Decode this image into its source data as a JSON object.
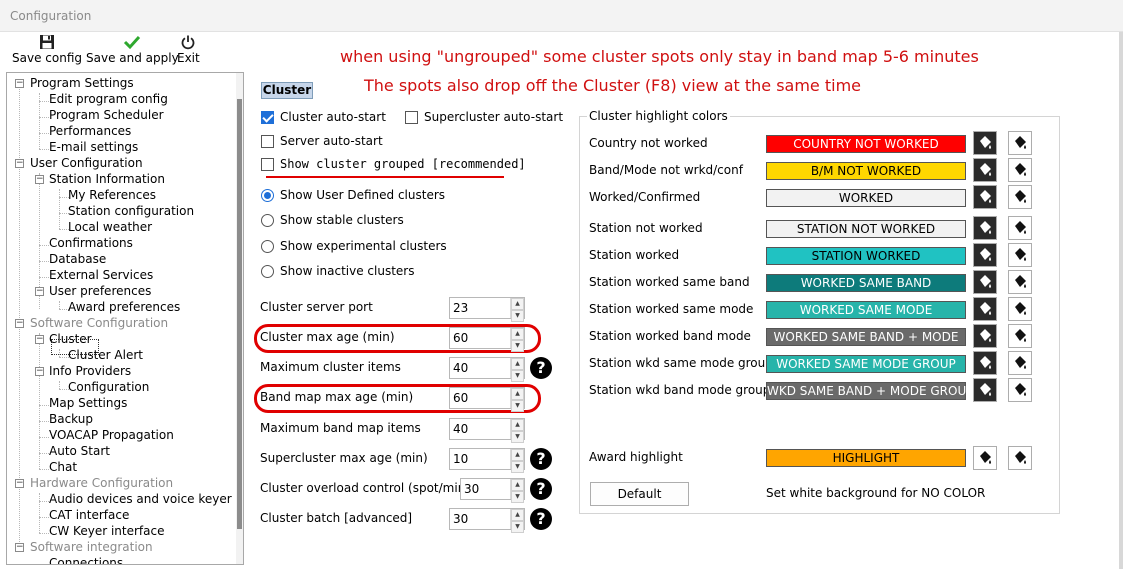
{
  "window": {
    "title": "Configuration"
  },
  "toolbar": {
    "save_config": "Save config",
    "save_apply": "Save and apply",
    "exit": "Exit"
  },
  "annotations": {
    "line1": "when using \"ungrouped\" some cluster spots only stay in band map 5-6 minutes",
    "line2": "The spots also drop off the Cluster (F8) view at the same time"
  },
  "tree": [
    {
      "label": "Program Settings"
    },
    {
      "label": "Edit program config"
    },
    {
      "label": "Program Scheduler"
    },
    {
      "label": "Performances"
    },
    {
      "label": "E-mail settings"
    },
    {
      "label": "User Configuration"
    },
    {
      "label": "Station Information"
    },
    {
      "label": "My References"
    },
    {
      "label": "Station configuration"
    },
    {
      "label": "Local weather"
    },
    {
      "label": "Confirmations"
    },
    {
      "label": "Database"
    },
    {
      "label": "External Services"
    },
    {
      "label": "User preferences"
    },
    {
      "label": "Award preferences"
    },
    {
      "label": "Software Configuration"
    },
    {
      "label": "Cluster"
    },
    {
      "label": "Cluster Alert"
    },
    {
      "label": "Info Providers"
    },
    {
      "label": "Configuration"
    },
    {
      "label": "Map Settings"
    },
    {
      "label": "Backup"
    },
    {
      "label": "VOACAP Propagation"
    },
    {
      "label": "Auto Start"
    },
    {
      "label": "Chat"
    },
    {
      "label": "Hardware Configuration"
    },
    {
      "label": "Audio devices and voice keyer"
    },
    {
      "label": "CAT interface"
    },
    {
      "label": "CW Keyer interface"
    },
    {
      "label": "Software integration"
    },
    {
      "label": "Connections"
    }
  ],
  "cluster": {
    "section_title": "Cluster",
    "checkboxes": {
      "auto_start": "Cluster auto-start",
      "supercluster_auto_start": "Supercluster auto-start",
      "server_auto_start": "Server auto-start",
      "show_grouped": "Show cluster grouped [recommended]"
    },
    "radios": {
      "user_defined": "Show User Defined clusters",
      "stable": "Show stable clusters",
      "experimental": "Show experimental clusters",
      "inactive": "Show inactive clusters"
    },
    "fields": [
      {
        "label": "Cluster server port",
        "value": "23"
      },
      {
        "label": "Cluster max age (min)",
        "value": "60"
      },
      {
        "label": "Maximum cluster items",
        "value": "40"
      },
      {
        "label": "Band map max age (min)",
        "value": "60"
      },
      {
        "label": "Maximum band map items",
        "value": "40"
      },
      {
        "label": "Supercluster max age (min)",
        "value": "10"
      },
      {
        "label": "Cluster overload control (spot/min)",
        "value": "30"
      },
      {
        "label": "Cluster batch [advanced]",
        "value": "30"
      }
    ],
    "help_glyph": "?"
  },
  "highlight": {
    "title": "Cluster highlight colors",
    "rows": [
      {
        "label": "Country not worked",
        "sample": "COUNTRY NOT WORKED",
        "bg": "#ff0000",
        "fg": "#ffffff"
      },
      {
        "label": "Band/Mode not wrkd/conf",
        "sample": "B/M NOT WORKED",
        "bg": "#ffd700",
        "fg": "#000000"
      },
      {
        "label": "Worked/Confirmed",
        "sample": "WORKED",
        "bg": "#f2f2f2",
        "fg": "#000000"
      },
      {
        "label": "Station not worked",
        "sample": "STATION NOT WORKED",
        "bg": "#f2f2f2",
        "fg": "#000000"
      },
      {
        "label": "Station worked",
        "sample": "STATION WORKED",
        "bg": "#20c2c2",
        "fg": "#000000"
      },
      {
        "label": "Station worked same band",
        "sample": "WORKED SAME BAND",
        "bg": "#0d7b7b",
        "fg": "#ffffff"
      },
      {
        "label": "Station worked same mode",
        "sample": "WORKED SAME MODE",
        "bg": "#27b4aa",
        "fg": "#ffffff"
      },
      {
        "label": "Station worked band mode",
        "sample": "WORKED SAME BAND + MODE",
        "bg": "#6a6a6a",
        "fg": "#ffffff"
      },
      {
        "label": "Station wkd same mode group",
        "sample": "WORKED SAME MODE GROUP",
        "bg": "#27b4aa",
        "fg": "#ffffff"
      },
      {
        "label": "Station wkd band mode group",
        "sample": "WKD SAME BAND + MODE GROUP",
        "bg": "#6a6a6a",
        "fg": "#ffffff"
      }
    ],
    "award": {
      "label": "Award highlight",
      "sample": "HIGHLIGHT",
      "bg": "#ffa500",
      "fg": "#000000"
    },
    "default_button": "Default",
    "white_bg_note": "Set white background for NO COLOR"
  },
  "icons": {
    "save": "floppy-disk-icon",
    "apply": "green-check-icon",
    "exit": "power-icon",
    "fg_color": "paint-bucket-icon",
    "bg_color": "paint-bucket-icon"
  }
}
